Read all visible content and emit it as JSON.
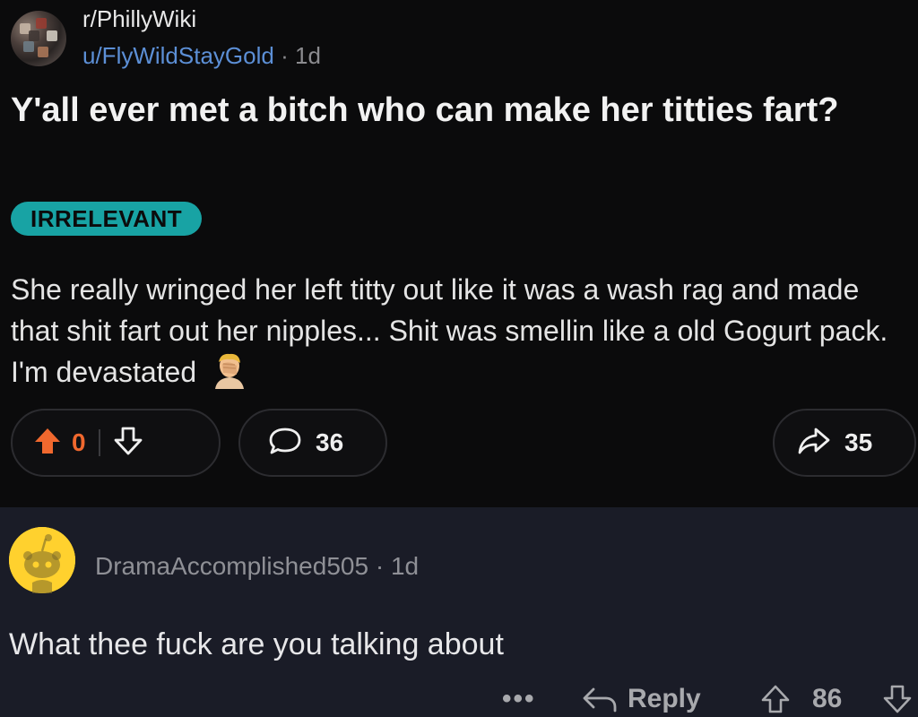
{
  "post": {
    "subreddit": "r/PhillyWiki",
    "author": "u/FlyWildStayGold",
    "separator": "·",
    "age": "1d",
    "title": "Y'all ever met a bitch who can make her titties fart?",
    "flair": "IRRELEVANT",
    "body": "She really wringed her left titty out like it was a wash rag and made that shit fart out her nipples... Shit was smellin like a old Gogurt pack. I'm devastated",
    "emoji": "face-palm-emoji",
    "votes": "0",
    "comments": "36",
    "shares": "35"
  },
  "comment": {
    "author": "DramaAccomplished505",
    "separator": "·",
    "age": "1d",
    "text": "What thee fuck are you talking about",
    "more": "•••",
    "reply_label": "Reply",
    "votes": "86"
  },
  "colors": {
    "background_post": "#0b0b0c",
    "background_comment": "#1a1c27",
    "flair_bg": "#18a3a4",
    "author_link": "#5c8fd6",
    "upvote_active": "#f0682e",
    "avatar_yellow": "#ffd12e"
  }
}
